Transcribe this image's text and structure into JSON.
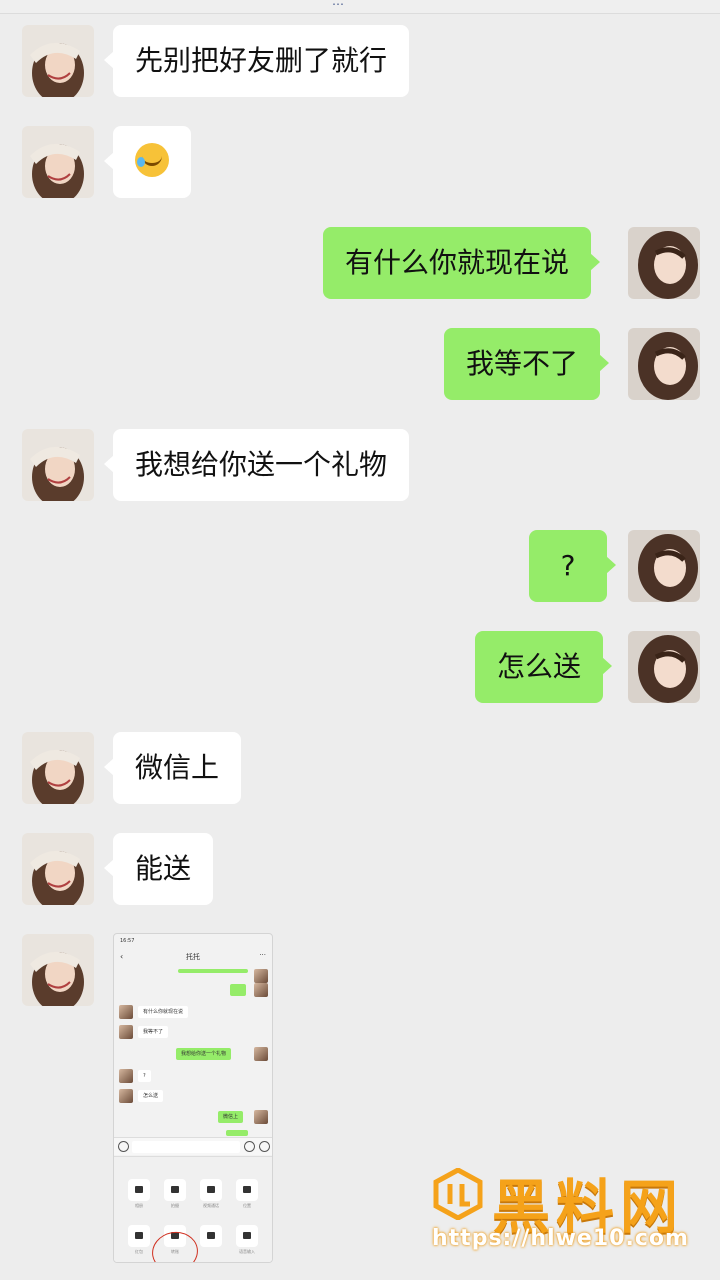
{
  "top_text": "…",
  "messages": [
    {
      "side": "in",
      "text": "先别把好友删了就行"
    },
    {
      "side": "in",
      "emoji": "laughing-crying-emoji"
    },
    {
      "side": "out",
      "text": "有什么你就现在说"
    },
    {
      "side": "out",
      "text": "我等不了"
    },
    {
      "side": "in",
      "text": "我想给你送一个礼物"
    },
    {
      "side": "out",
      "text": "?"
    },
    {
      "side": "out",
      "text": "怎么送"
    },
    {
      "side": "in",
      "text": "微信上"
    },
    {
      "side": "in",
      "text": "能送"
    }
  ],
  "screenshot": {
    "status_time": "16:57",
    "title": "托托",
    "messages": [
      {
        "side": "in",
        "text": "有什么你就现在说"
      },
      {
        "side": "in",
        "text": "我等不了"
      },
      {
        "side": "out",
        "text": "我想给你送一个礼物"
      },
      {
        "side": "in",
        "text": "?"
      },
      {
        "side": "in",
        "text": "怎么送"
      },
      {
        "side": "out",
        "text": "微信上"
      }
    ],
    "tools": [
      "相册",
      "拍摄",
      "视频通话",
      "位置",
      "红包",
      "转账",
      "语音输入"
    ]
  },
  "watermark": {
    "name": "黑料网",
    "url": "https://hlwe10.com"
  },
  "colors": {
    "background": "#ededed",
    "bubble_in": "#ffffff",
    "bubble_out": "#95ec69",
    "watermark": "#f5a21a"
  }
}
